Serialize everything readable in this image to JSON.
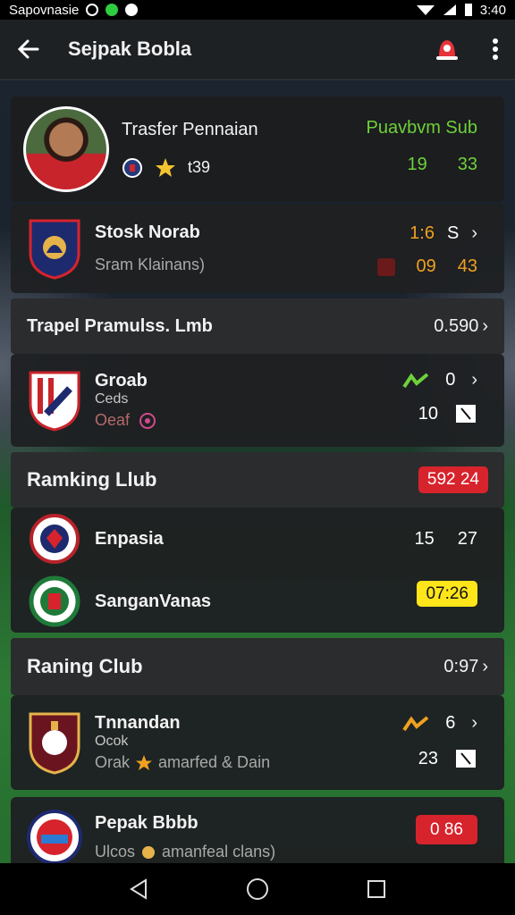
{
  "status_bar": {
    "carrier": "Sapovnasie",
    "time": "3:40"
  },
  "app_bar": {
    "title": "Sejpak Bobla",
    "back_icon": "arrow-left-icon",
    "alert_icon": "bell-alert-icon",
    "menu_icon": "more-vertical-icon"
  },
  "player": {
    "name": "Trasfer Pennaian",
    "label": "Puavbvm Sub",
    "rating": "t39",
    "stat1": "19",
    "stat2": "33"
  },
  "club1": {
    "name": "Stosk Norab",
    "subtitle": "Sram Klainans)",
    "top1": "1:6",
    "top2": "S",
    "bottom1": "09",
    "bottom2": "43"
  },
  "section1": {
    "label": "Trapel Pramulss. Lmb",
    "value": "0.590"
  },
  "club2": {
    "name": "Groab",
    "line2": "Ceds",
    "line3": "Oeaf",
    "top": "0",
    "bottom": "10"
  },
  "section2": {
    "label": "Ramking Llub",
    "badge": "592 24"
  },
  "club3": {
    "name": "Enpasia",
    "v1": "15",
    "v2": "27"
  },
  "club4": {
    "name": "SanganVanas",
    "badge": "07:26"
  },
  "section3": {
    "label": "Raning Club",
    "value": "0:97"
  },
  "club5": {
    "name": "Tnnandan",
    "line2": "Ocok",
    "line3": "Orak",
    "line3b": "amarfed & Dain",
    "top": "6",
    "bottom": "23"
  },
  "club6": {
    "name": "Pepak Bbbb",
    "subtitle": "Ulcos",
    "subtitle_b": "amanfeal clans)",
    "badge": "0 86"
  },
  "colors": {
    "accent_green": "#6fd13a",
    "accent_orange": "#f0a020",
    "badge_red": "#d7232c",
    "badge_yellow": "#ffe51a"
  }
}
